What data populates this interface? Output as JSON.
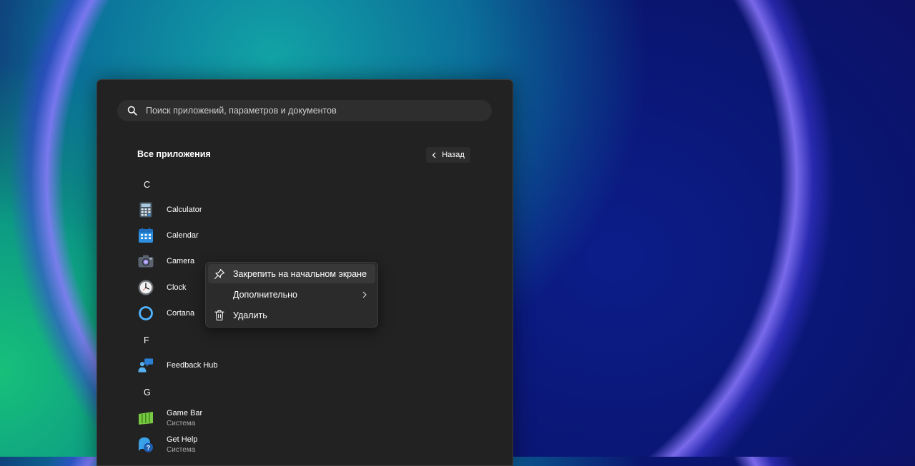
{
  "search": {
    "placeholder": "Поиск приложений, параметров и документов"
  },
  "all_apps": {
    "title": "Все приложения",
    "back_label": "Назад"
  },
  "groups": [
    {
      "letter": "C"
    },
    {
      "letter": "F"
    },
    {
      "letter": "G"
    }
  ],
  "apps": [
    {
      "label": "Calculator",
      "icon": "calculator-icon"
    },
    {
      "label": "Calendar",
      "icon": "calendar-icon"
    },
    {
      "label": "Camera",
      "icon": "camera-icon"
    },
    {
      "label": "Clock",
      "icon": "clock-icon"
    },
    {
      "label": "Cortana",
      "icon": "cortana-icon"
    },
    {
      "label": "Feedback Hub",
      "icon": "feedback-hub-icon"
    },
    {
      "label": "Game Bar",
      "sublabel": "Система",
      "icon": "game-bar-icon"
    },
    {
      "label": "Get Help",
      "sublabel": "Система",
      "icon": "get-help-icon"
    }
  ],
  "context_menu": {
    "items": [
      {
        "label": "Закрепить на начальном экране",
        "icon": "pin-icon"
      },
      {
        "label": "Дополнительно",
        "icon": "chevron-right-icon"
      },
      {
        "label": "Удалить",
        "icon": "trash-icon"
      }
    ]
  }
}
